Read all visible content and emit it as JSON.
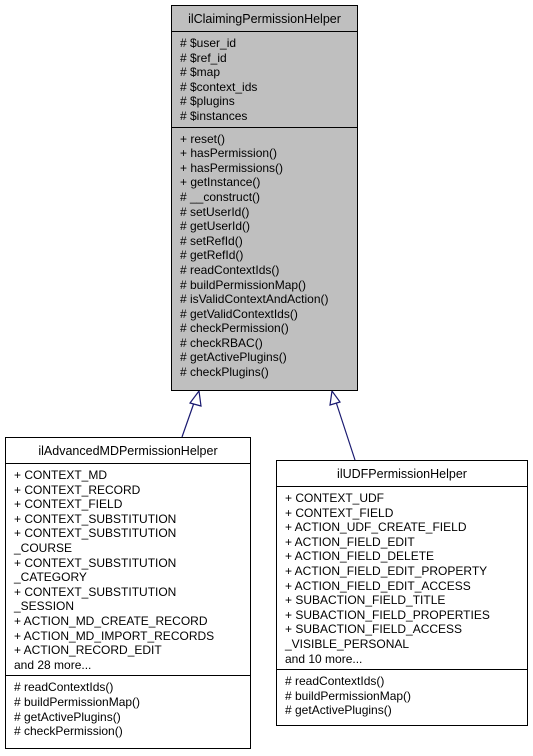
{
  "diagram": {
    "base_class": {
      "name": "ilClaimingPermissionHelper",
      "attributes": [
        "# $user_id",
        "# $ref_id",
        "# $map",
        "# $context_ids",
        "# $plugins",
        "# $instances"
      ],
      "methods": [
        "+ reset()",
        "+ hasPermission()",
        "+ hasPermissions()",
        "+ getInstance()",
        "# __construct()",
        "# setUserId()",
        "# getUserId()",
        "# setRefId()",
        "# getRefId()",
        "# readContextIds()",
        "# buildPermissionMap()",
        "# isValidContextAndAction()",
        "# getValidContextIds()",
        "# checkPermission()",
        "# checkRBAC()",
        "# getActivePlugins()",
        "# checkPlugins()"
      ]
    },
    "derived_classes": [
      {
        "name": "ilAdvancedMDPermissionHelper",
        "attributes": [
          "+ CONTEXT_MD",
          "+ CONTEXT_RECORD",
          "+ CONTEXT_FIELD",
          "+ CONTEXT_SUBSTITUTION",
          "+ CONTEXT_SUBSTITUTION",
          "_COURSE",
          "+ CONTEXT_SUBSTITUTION",
          "_CATEGORY",
          "+ CONTEXT_SUBSTITUTION",
          "_SESSION",
          "+ ACTION_MD_CREATE_RECORD",
          "+ ACTION_MD_IMPORT_RECORDS",
          "+ ACTION_RECORD_EDIT",
          "and 28 more..."
        ],
        "methods": [
          "# readContextIds()",
          "# buildPermissionMap()",
          "# getActivePlugins()",
          "# checkPermission()"
        ]
      },
      {
        "name": "ilUDFPermissionHelper",
        "attributes": [
          "+ CONTEXT_UDF",
          "+ CONTEXT_FIELD",
          "+ ACTION_UDF_CREATE_FIELD",
          "+ ACTION_FIELD_EDIT",
          "+ ACTION_FIELD_DELETE",
          "+ ACTION_FIELD_EDIT_PROPERTY",
          "+ ACTION_FIELD_EDIT_ACCESS",
          "+ SUBACTION_FIELD_TITLE",
          "+ SUBACTION_FIELD_PROPERTIES",
          "+ SUBACTION_FIELD_ACCESS",
          "_VISIBLE_PERSONAL",
          "and 10 more..."
        ],
        "methods": [
          "# readContextIds()",
          "# buildPermissionMap()",
          "# getActivePlugins()"
        ]
      }
    ],
    "relations": [
      {
        "type": "inheritance",
        "from": "ilAdvancedMDPermissionHelper",
        "to": "ilClaimingPermissionHelper"
      },
      {
        "type": "inheritance",
        "from": "ilUDFPermissionHelper",
        "to": "ilClaimingPermissionHelper"
      }
    ],
    "colors": {
      "base_fill": "#bfbfbf",
      "derived_fill": "#ffffff",
      "edge": "#191970",
      "border": "#000000"
    }
  }
}
